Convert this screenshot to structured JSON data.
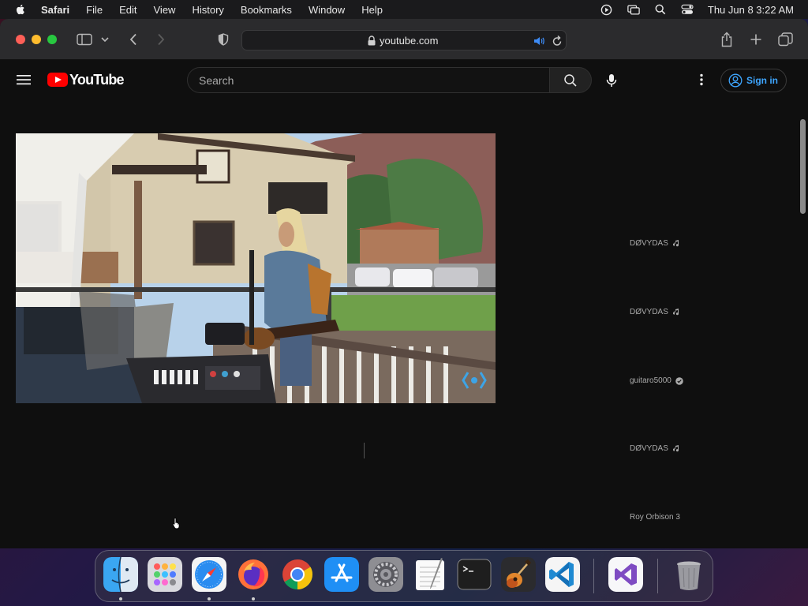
{
  "menubar": {
    "app_name": "Safari",
    "items": [
      "File",
      "Edit",
      "View",
      "History",
      "Bookmarks",
      "Window",
      "Help"
    ],
    "clock": "Thu Jun 8  3:22 AM",
    "tray_icons": [
      "play-circle-icon",
      "screen-mirroring-icon",
      "spotlight-search-icon",
      "control-center-icon"
    ]
  },
  "browser": {
    "url": "youtube.com",
    "toolbar_icons": [
      "sidebar-icon",
      "chevron-down-icon",
      "back-icon",
      "forward-icon",
      "privacy-shield-icon",
      "share-icon",
      "new-tab-icon",
      "tab-overview-icon"
    ]
  },
  "youtube": {
    "logo_text": "YouTube",
    "search_placeholder": "Search",
    "signin_label": "Sign in",
    "recommendations": [
      {
        "channel": "DØVYDAS",
        "badge": "music-note-icon"
      },
      {
        "channel": "DØVYDAS",
        "badge": "music-note-icon"
      },
      {
        "channel": "guitaro5000",
        "badge": "verified-check-icon"
      },
      {
        "channel": "DØVYDAS",
        "badge": "music-note-icon"
      },
      {
        "channel": "Roy Orbison 3",
        "badge": ""
      }
    ]
  },
  "dock": {
    "apps": [
      "finder",
      "launchpad",
      "safari",
      "firefox",
      "chrome",
      "app-store",
      "system-preferences",
      "textedit",
      "terminal",
      "garageband",
      "vscode",
      "visual-studio",
      "trash"
    ]
  },
  "colors": {
    "yt_red": "#ff0000",
    "signin_blue": "#3ea6ff",
    "page_bg": "#0f0f0f"
  }
}
